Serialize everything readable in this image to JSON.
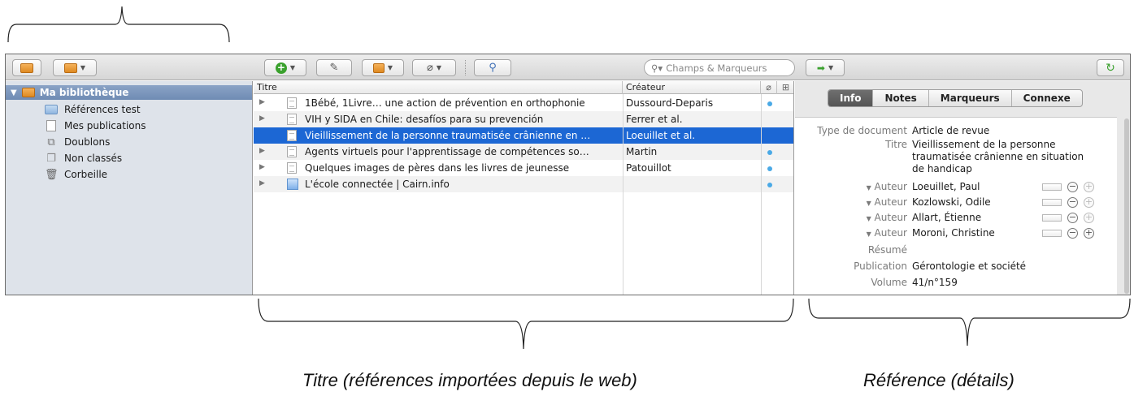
{
  "toolbar": {
    "search_placeholder": "Champs & Marqueurs"
  },
  "sidebar": {
    "library": "Ma bibliothèque",
    "items": [
      {
        "label": "Références test",
        "icon": "folder-icon"
      },
      {
        "label": "Mes publications",
        "icon": "document-icon"
      },
      {
        "label": "Doublons",
        "icon": "duplicates-icon"
      },
      {
        "label": "Non classés",
        "icon": "unfiled-icon"
      },
      {
        "label": "Corbeille",
        "icon": "trash-icon"
      }
    ]
  },
  "items": {
    "columns": {
      "title": "Titre",
      "creator": "Créateur"
    },
    "rows": [
      {
        "title": "1Bébé, 1Livre… une action de prévention en orthophonie",
        "creator": "Dussourd-Deparis",
        "attachment": true
      },
      {
        "title": "VIH y SIDA en Chile: desafíos para su prevención",
        "creator": "Ferrer et al.",
        "attachment": false
      },
      {
        "title": "Vieillissement de la personne traumatisée crânienne en …",
        "creator": "Loeuillet et al.",
        "attachment": false,
        "selected": true
      },
      {
        "title": "Agents virtuels pour l'apprentissage de compétences so…",
        "creator": "Martin",
        "attachment": true
      },
      {
        "title": "Quelques images de pères dans les livres de jeunesse",
        "creator": "Patouillot",
        "attachment": true
      },
      {
        "title": "L'école connectée | Cairn.info",
        "creator": "",
        "attachment": true
      }
    ]
  },
  "detail": {
    "tabs": [
      "Info",
      "Notes",
      "Marqueurs",
      "Connexe"
    ],
    "active_tab": "Info",
    "fields": {
      "type_label": "Type de document",
      "type_value": "Article de revue",
      "title_label": "Titre",
      "title_value": "Vieillissement de la personne traumatisée crânienne en situation de handicap",
      "author_label": "Auteur",
      "authors": [
        "Loeuillet, Paul",
        "Kozlowski, Odile",
        "Allart, Étienne",
        "Moroni, Christine"
      ],
      "abstract_label": "Résumé",
      "publication_label": "Publication",
      "publication_value": "Gérontologie et société",
      "volume_label": "Volume",
      "volume_value": "41/n°159"
    }
  },
  "captions": {
    "items": "Titre (références importées depuis le web)",
    "detail": "Référence (détails)"
  },
  "colors": {
    "selection": "#1c67d4",
    "sidebar_bg": "#dee3ea",
    "library_row": "#7891b9"
  }
}
